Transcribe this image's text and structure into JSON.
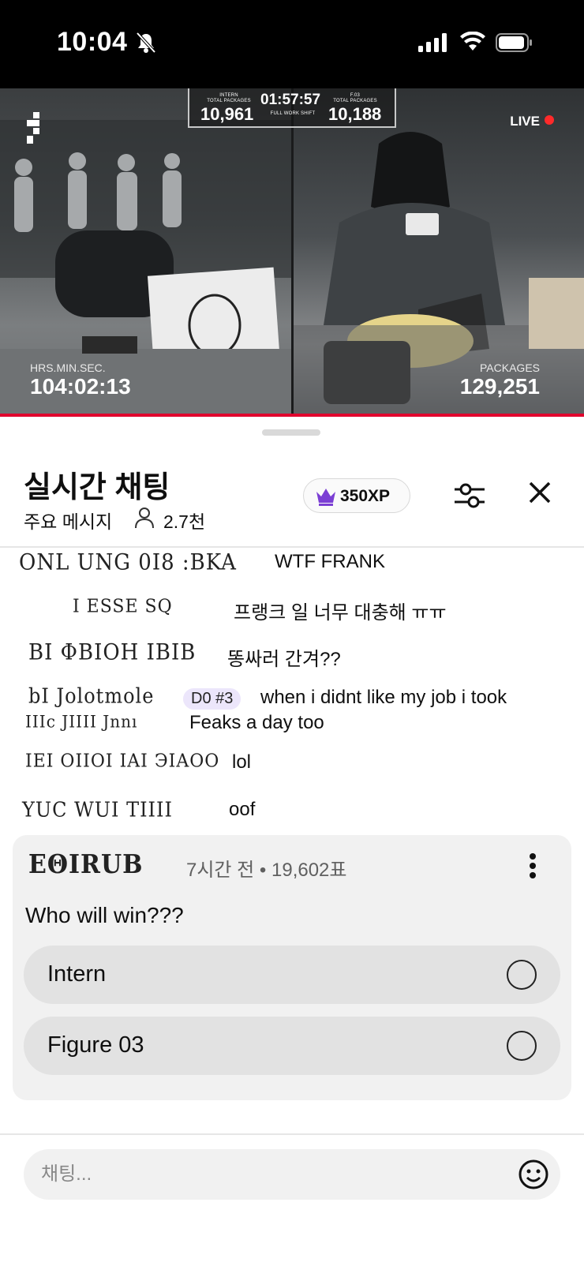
{
  "status_bar": {
    "time": "10:04"
  },
  "video": {
    "scoreboard": {
      "left_label_1": "INTERN",
      "left_label_2": "TOTAL PACKAGES",
      "left_value": "10,961",
      "center_value": "01:57:57",
      "center_label": "FULL WORK SHIFT",
      "right_label_1": "F.03",
      "right_label_2": "TOTAL PACKAGES",
      "right_value": "10,188"
    },
    "live_label": "LIVE",
    "left_caption": "HRS.MIN.SEC.",
    "left_value": "104:02:13",
    "right_caption": "PACKAGES",
    "right_value": "129,251"
  },
  "chat": {
    "title": "실시간 채팅",
    "subtitle": "주요 메시지",
    "viewer_count": "2.7천",
    "xp": "350XP",
    "messages": [
      {
        "author": "ONL UNG 0I8 :BKA",
        "text": "WTF FRANK"
      },
      {
        "author": "I  ESSE SQ",
        "text": "프랭크 일 너무 대충해 ㅠㅠ"
      },
      {
        "author": "BI ΦBIOH IBIB",
        "text": "똥싸러 간겨??"
      },
      {
        "author": "bI Jolotmole",
        "badge": "D0 #3",
        "text": "when i didnt like my job i took",
        "text2_author": "IIIc JIIII Jnnı",
        "text2": "Feaks a day too"
      },
      {
        "author": "IEI OIIOI IAI ЭIAOO",
        "text": "lol"
      },
      {
        "author": "YUC WUI TIIII",
        "text": "oof"
      }
    ]
  },
  "poll": {
    "author": "EΘIRUB",
    "meta": "7시간 전 • 19,602표",
    "question": "Who will win???",
    "options": [
      {
        "label": "Intern"
      },
      {
        "label": "Figure 03"
      }
    ]
  },
  "input": {
    "placeholder": "채팅..."
  },
  "colors": {
    "live_dot": "#ff2a2a",
    "crown": "#7b3fd4",
    "progress": "#e1002d"
  }
}
